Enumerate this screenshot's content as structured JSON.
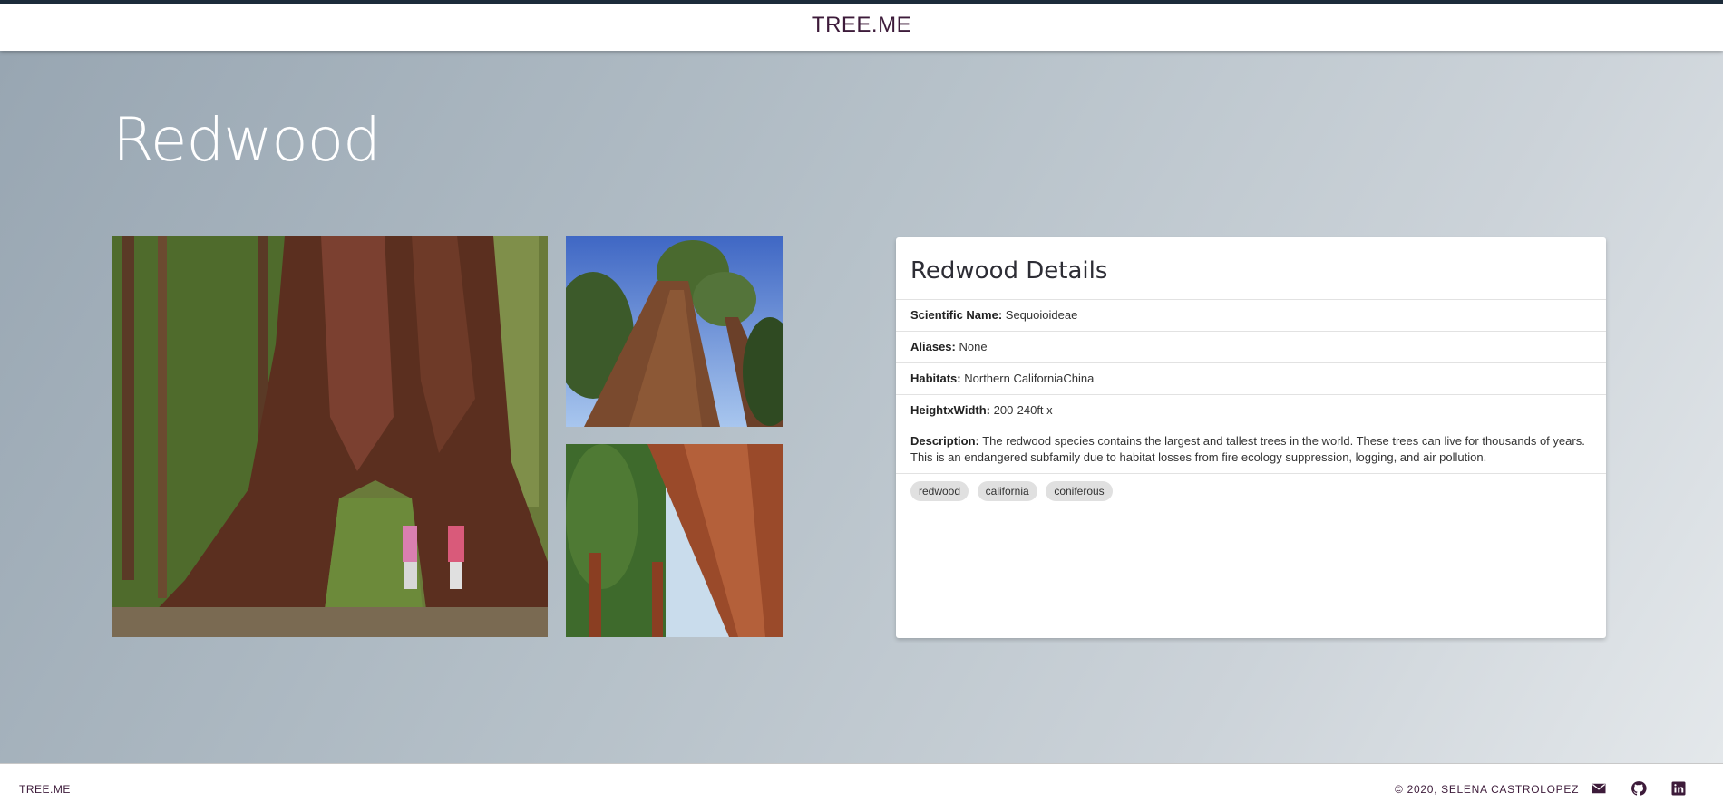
{
  "app": {
    "brand": "TREE.ME"
  },
  "page": {
    "title": "Redwood"
  },
  "details": {
    "title": "Redwood Details",
    "scientific_label": "Scientific Name:",
    "scientific_value": "Sequoioideae",
    "aliases_label": "Aliases:",
    "aliases_value": "None",
    "habitats_label": "Habitats:",
    "habitats_value": "Northern CaliforniaChina",
    "height_label": "HeightxWidth:",
    "height_value": "200-240ft x",
    "description_label": "Description:",
    "description_value": "The redwood species contains the largest and tallest trees in the world. These trees can live for thousands of years. This is an endangered subfamily due to habitat losses from fire ecology suppression, logging, and air pollution.",
    "tags": [
      "redwood",
      "california",
      "coniferous"
    ]
  },
  "footer": {
    "brand": "TREE.ME",
    "copyright": "© 2020,  SELENA CASTROLOPEZ",
    "icons": [
      "mail-icon",
      "github-icon",
      "linkedin-icon"
    ]
  },
  "colors": {
    "brand": "#3d1b3a",
    "header_border": "#1c2b3a"
  }
}
